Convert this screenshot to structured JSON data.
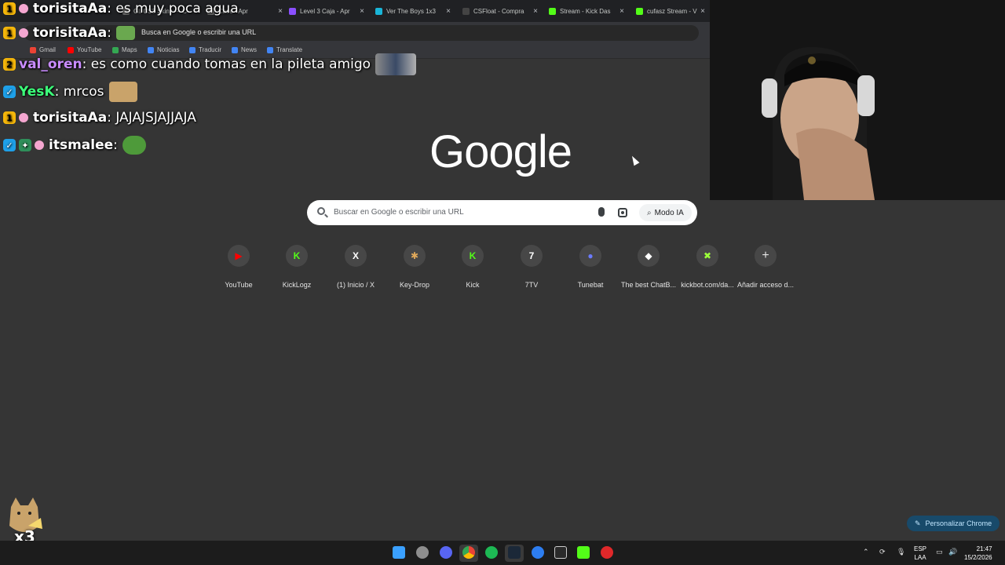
{
  "browser": {
    "tabs": [
      {
        "title": "Gl. CS2 Skins — C",
        "fav": "#6b6b6b"
      },
      {
        "title": "Case - Apr",
        "fav": "#6b6b6b"
      },
      {
        "title": "Level 3 Caja - Apr",
        "fav": "#8a4fff"
      },
      {
        "title": "Ver The Boys 1x3",
        "fav": "#19b5d8"
      },
      {
        "title": "CSFloat - Compra",
        "fav": "#444"
      },
      {
        "title": "Stream - Kick Das",
        "fav": "#53fc18"
      },
      {
        "title": "cufasz Stream - V",
        "fav": "#53fc18"
      }
    ],
    "close_glyph": "×",
    "omnibox_text": "Busca en Google o escribir una URL",
    "bookmarks": [
      {
        "label": "Gmail",
        "color": "#ea4335"
      },
      {
        "label": "YouTube",
        "color": "#ff0000"
      },
      {
        "label": "Maps",
        "color": "#34a853"
      },
      {
        "label": "Noticias",
        "color": "#4285f4"
      },
      {
        "label": "Traducir",
        "color": "#4285f4"
      },
      {
        "label": "News",
        "color": "#4285f4"
      },
      {
        "label": "Translate",
        "color": "#4285f4"
      }
    ]
  },
  "chat": [
    {
      "badge": "1",
      "badge_type": "sub",
      "user": "torisitaAa",
      "user_color": "#ffffff",
      "message": ": es muy poca agua"
    },
    {
      "badge": "1",
      "badge_type": "sub",
      "user": "torisitaAa",
      "user_color": "#ffffff",
      "message": ":"
    },
    {
      "badge": "2",
      "badge_type": "sub",
      "user": "val_oren",
      "user_color": "#c98cff",
      "message": ": es como cuando tomas en la pileta amigo"
    },
    {
      "badge": "✓",
      "badge_type": "vip",
      "user": "YesK",
      "user_color": "#3cff7a",
      "message": ": mrcos"
    },
    {
      "badge": "1",
      "badge_type": "sub",
      "user": "torisitaAa",
      "user_color": "#ffffff",
      "message": ": JAJAJSJAJJAJA"
    },
    {
      "badge": "✓",
      "badge_type": "vip",
      "user": "itsmalee",
      "user_color": "#ffffff",
      "message": ":"
    }
  ],
  "google": {
    "logo": "Google",
    "search_placeholder": "Buscar en Google o escribir una URL",
    "ai_mode": "Modo IA",
    "shortcuts": [
      {
        "label": "YouTube",
        "glyph": "▶",
        "color": "#ff0000"
      },
      {
        "label": "KickLogz",
        "glyph": "K",
        "color": "#53fc18"
      },
      {
        "label": "(1) Inicio / X",
        "glyph": "X",
        "color": "#ffffff"
      },
      {
        "label": "Key-Drop",
        "glyph": "✱",
        "color": "#e0a95a"
      },
      {
        "label": "Kick",
        "glyph": "K",
        "color": "#53fc18"
      },
      {
        "label": "7TV",
        "glyph": "7",
        "color": "#ffffff"
      },
      {
        "label": "Tunebat",
        "glyph": "●",
        "color": "#6b7bff"
      },
      {
        "label": "The best ChatB...",
        "glyph": "◆",
        "color": "#ffffff"
      },
      {
        "label": "kickbot.com/da...",
        "glyph": "✖",
        "color": "#9cff3a"
      },
      {
        "label": "Añadir acceso d...",
        "glyph": "+",
        "color": "#e3e3e3"
      }
    ],
    "customize": "Personalizar Chrome"
  },
  "overlay": {
    "combo": "x3"
  },
  "taskbar": {
    "apps": [
      {
        "name": "windows-start",
        "color": "#3aa0ff"
      },
      {
        "name": "app-2",
        "color": "#8e8e8e"
      },
      {
        "name": "discord",
        "color": "#5865f2"
      },
      {
        "name": "chrome",
        "color": "#4285f4"
      },
      {
        "name": "spotify",
        "color": "#1db954"
      },
      {
        "name": "steam",
        "color": "#66c0f4"
      },
      {
        "name": "app-7",
        "color": "#2d7df0"
      },
      {
        "name": "epic",
        "color": "#cccccc"
      },
      {
        "name": "kick",
        "color": "#53fc18"
      },
      {
        "name": "app-10",
        "color": "#e0282a"
      }
    ],
    "lang_top": "ESP",
    "lang_bottom": "LAA",
    "time": "21:47",
    "date": "15/2/2026"
  }
}
